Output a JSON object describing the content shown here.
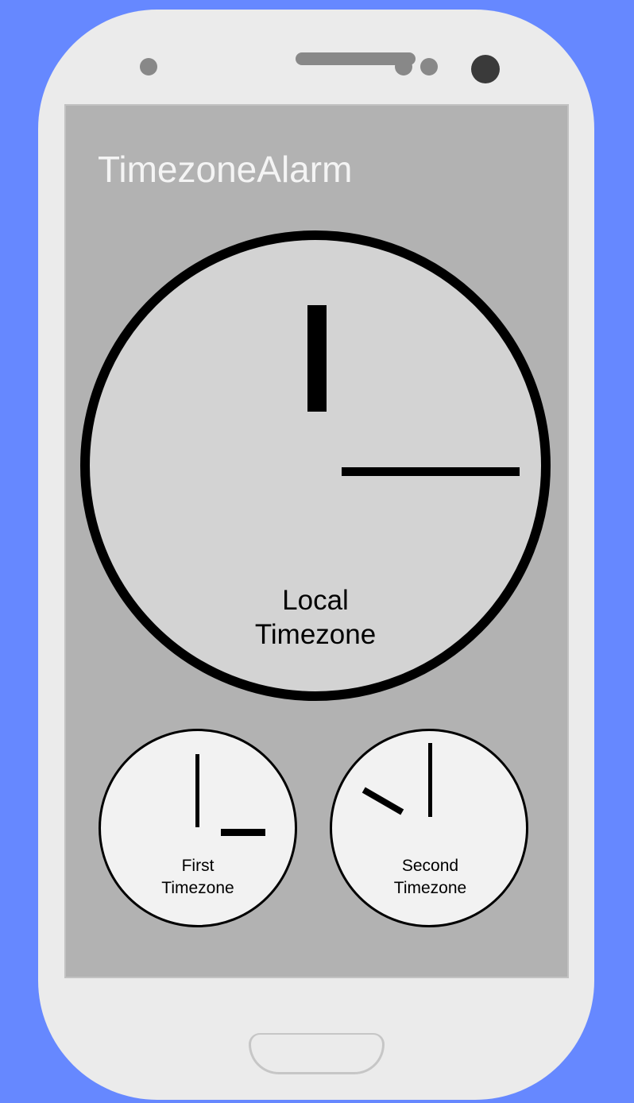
{
  "app": {
    "title": "TimezoneAlarm"
  },
  "clocks": {
    "local": {
      "label_line1": "Local",
      "label_line2": "Timezone"
    },
    "first": {
      "label_line1": "First",
      "label_line2": "Timezone"
    },
    "second": {
      "label_line1": "Second",
      "label_line2": "Timezone"
    }
  },
  "colors": {
    "background": "#6688ff",
    "phone_body": "#ebebeb",
    "screen": "#b2b2b2",
    "local_clock_face": "#d3d3d3",
    "small_clock_face": "#f2f2f2",
    "clock_ink": "#000000",
    "title_text": "#f4f4f4"
  }
}
